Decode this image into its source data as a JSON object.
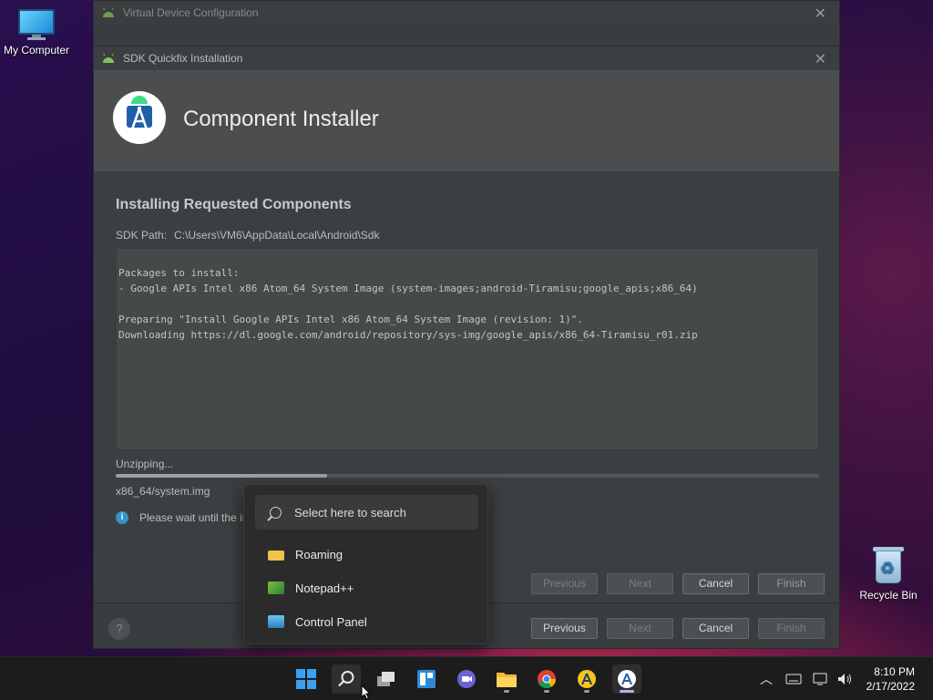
{
  "desktop": {
    "icons": [
      {
        "label": "My Computer"
      },
      {
        "label": "Recycle Bin"
      }
    ]
  },
  "back_window": {
    "title": "Virtual Device Configuration",
    "buttons": {
      "previous": "Previous",
      "next": "Next",
      "cancel": "Cancel",
      "finish": "Finish"
    },
    "help": "?"
  },
  "front_window": {
    "title": "SDK Quickfix Installation",
    "header_title": "Component Installer",
    "section_title": "Installing Requested Components",
    "sdk_path_label": "SDK Path:",
    "sdk_path_value": "C:\\Users\\VM6\\AppData\\Local\\Android\\Sdk",
    "log_lines": [
      "Packages to install:",
      "- Google APIs Intel x86 Atom_64 System Image (system-images;android-Tiramisu;google_apis;x86_64)",
      "",
      "Preparing \"Install Google APIs Intel x86 Atom_64 System Image (revision: 1)\".",
      "Downloading https://dl.google.com/android/repository/sys-img/google_apis/x86_64-Tiramisu_r01.zip"
    ],
    "status_text": "Unzipping...",
    "progress_percent": 30,
    "current_file": "x86_64/system.img",
    "info_text": "Please wait until the in",
    "buttons": {
      "previous": "Previous",
      "next": "Next",
      "cancel": "Cancel",
      "finish": "Finish"
    }
  },
  "search_flyout": {
    "placeholder": "Select here to search",
    "items": [
      {
        "label": "Roaming",
        "icon": "folder-icon"
      },
      {
        "label": "Notepad++",
        "icon": "notepad-plus-plus-icon"
      },
      {
        "label": "Control Panel",
        "icon": "control-panel-icon"
      }
    ]
  },
  "taskbar": {
    "clock_time": "8:10 PM",
    "clock_date": "2/17/2022"
  }
}
